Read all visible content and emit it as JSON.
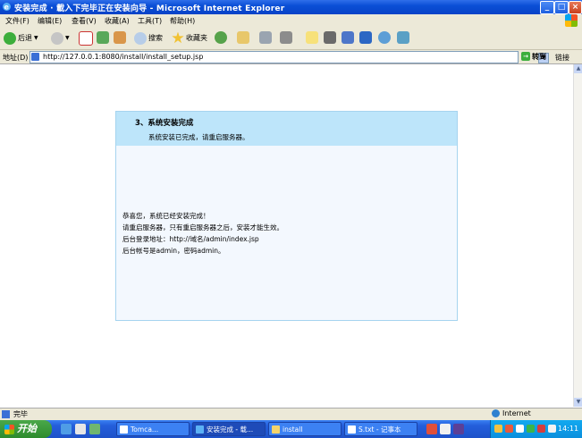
{
  "window": {
    "title": "安装完成 · 載入下完毕正在安装向导 - Microsoft Internet Explorer",
    "minimize_label": "_",
    "maximize_label": "□",
    "close_label": "×"
  },
  "menu": {
    "items": [
      "文件(F)",
      "编辑(E)",
      "查看(V)",
      "收藏(A)",
      "工具(T)",
      "帮助(H)"
    ]
  },
  "toolbar": {
    "back_label": "后退",
    "search_label": "搜索",
    "favorites_label": "收藏夹"
  },
  "address": {
    "label": "地址(D)",
    "url": "http://127.0.0.1:8080/install/install_setup.jsp",
    "go_label": "转到",
    "links_label": "链接"
  },
  "content": {
    "step_title": "3、系统安装完成",
    "step_description": "系统安装已完成，请重启服务器。",
    "messages": [
      "恭喜您，系统已经安装完成！",
      "请重启服务器，只有重启服务器之后，安装才能生效。",
      "后台登录地址：http://域名/admin/index.jsp",
      "后台帐号是admin，密码admin。"
    ]
  },
  "statusbar": {
    "text": "完毕",
    "zone": "Internet"
  },
  "taskbar": {
    "start_label": "开始",
    "tasks": [
      {
        "label": "Tomca..."
      },
      {
        "label": "安装完成 - 载..."
      },
      {
        "label": "install"
      },
      {
        "label": "S.txt - 记事本"
      }
    ],
    "clock": "14:11"
  },
  "colors": {
    "panel_header_bg": "#bde5fa",
    "panel_body_bg": "#f3f8fe",
    "panel_border": "#a6d4ef",
    "titlebar_blue": "#0a4fd6"
  }
}
